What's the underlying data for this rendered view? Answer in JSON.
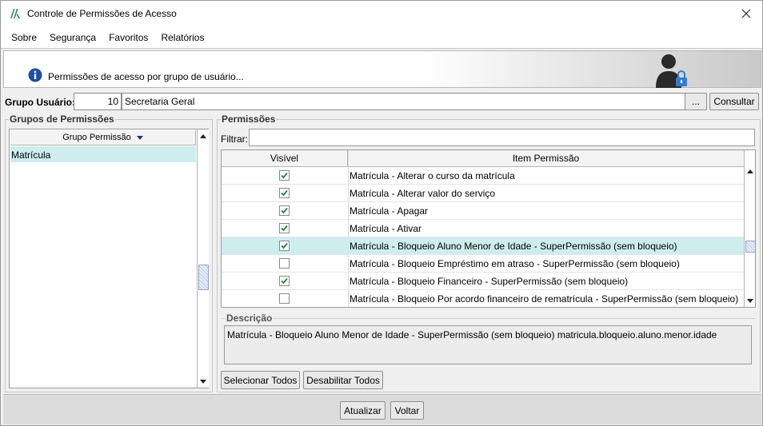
{
  "window": {
    "title": "Controle de Permissões de Acesso"
  },
  "menu": [
    {
      "label": "Sobre"
    },
    {
      "label": "Segurança"
    },
    {
      "label": "Favoritos"
    },
    {
      "label": "Relatórios"
    }
  ],
  "header": {
    "info_text": "Permissões de acesso por grupo de usuário..."
  },
  "grupo_usuario": {
    "label": "Grupo Usuário:",
    "code": "10",
    "name": "Secretaria Geral",
    "lookup_button": "...",
    "consultar_button": "Consultar"
  },
  "grupos_permissoes": {
    "legend": "Grupos de Permissões",
    "column": "Grupo Permissão",
    "rows": [
      "Matrícula"
    ]
  },
  "permissoes": {
    "legend": "Permissões",
    "filter_label": "Filtrar:",
    "filter_value": "",
    "columns": {
      "visible": "Visível",
      "item": "Item Permissão"
    },
    "rows": [
      {
        "visible": true,
        "item": "Matrícula - Alterar o curso da matrícula",
        "selected": false
      },
      {
        "visible": true,
        "item": "Matrícula - Alterar valor do serviço",
        "selected": false
      },
      {
        "visible": true,
        "item": "Matrícula - Apagar",
        "selected": false
      },
      {
        "visible": true,
        "item": "Matrícula - Ativar",
        "selected": false
      },
      {
        "visible": true,
        "item": "Matrícula - Bloqueio Aluno Menor de Idade - SuperPermissão (sem bloqueio)",
        "selected": true
      },
      {
        "visible": false,
        "item": "Matrícula - Bloqueio Empréstimo em atraso - SuperPermissão (sem bloqueio)",
        "selected": false
      },
      {
        "visible": true,
        "item": "Matrícula - Bloqueio Financeiro - SuperPermissão (sem bloqueio)",
        "selected": false
      },
      {
        "visible": false,
        "item": "Matrícula - Bloqueio Por acordo financeiro de rematrícula - SuperPermissão (sem bloqueio)",
        "selected": false
      }
    ],
    "description_label": "Descrição",
    "description": "Matrícula - Bloqueio Aluno Menor de Idade - SuperPermissão (sem bloqueio) matricula.bloqueio.aluno.menor.idade",
    "select_all_button": "Selecionar Todos",
    "disable_all_button": "Desabilitar Todos"
  },
  "footer": {
    "atualizar_button": "Atualizar",
    "voltar_button": "Voltar"
  },
  "colors": {
    "selection": "#cdeeed",
    "check": "#1f8a3b",
    "logo": "#1d7a5a"
  }
}
